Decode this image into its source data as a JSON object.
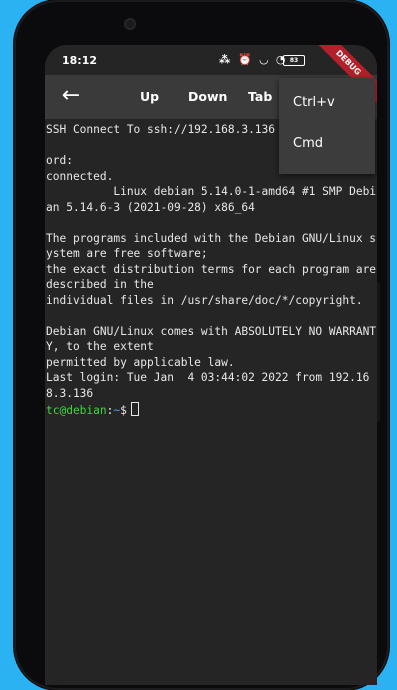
{
  "status_bar": {
    "time": "18:12",
    "icons_text": "⁂ ⏰ ◡ ◔",
    "battery": "83"
  },
  "toolbar": {
    "back_icon": "←",
    "up_label": "Up",
    "down_label": "Down",
    "tab_label": "Tab"
  },
  "debug_banner": "DEBUG",
  "menu": {
    "items": [
      "Ctrl+v",
      "Cmd"
    ]
  },
  "terminal": {
    "output": "SSH Connect To ssh://192.168.3.136\n\nord:\nconnected.\n          Linux debian 5.14.0-1-amd64 #1 SMP Debian 5.14.6-3 (2021-09-28) x86_64\n\nThe programs included with the Debian GNU/Linux system are free software;\nthe exact distribution terms for each program are described in the\nindividual files in /usr/share/doc/*/copyright.\n\nDebian GNU/Linux comes with ABSOLUTELY NO WARRANTY, to the extent\npermitted by applicable law.\nLast login: Tue Jan  4 03:44:02 2022 from 192.168.3.136",
    "prompt_user": "tc@debian",
    "prompt_sep": ":",
    "prompt_cwd": "~",
    "prompt_symbol": "$"
  }
}
